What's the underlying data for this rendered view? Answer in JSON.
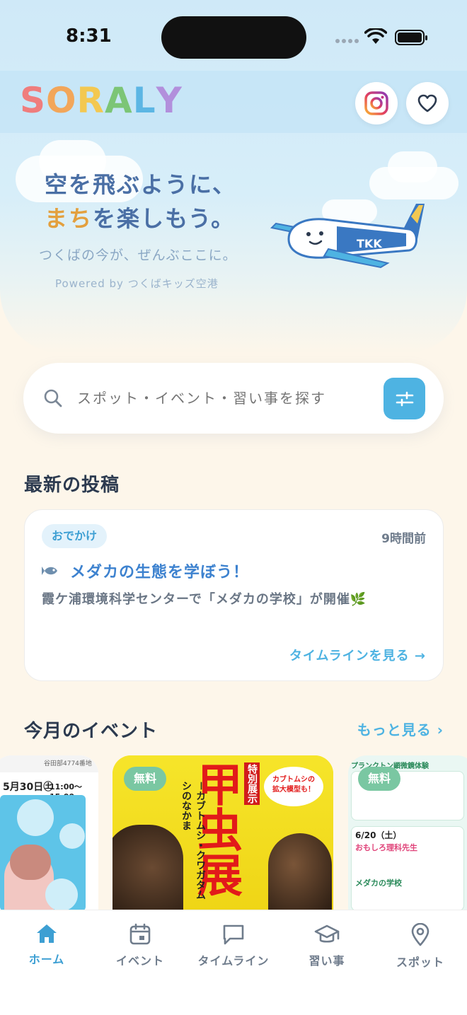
{
  "status_bar": {
    "time": "8:31"
  },
  "header": {
    "logo_letters": [
      {
        "char": "S",
        "color": "#ef7d7d"
      },
      {
        "char": "O",
        "color": "#f2a65a"
      },
      {
        "char": "R",
        "color": "#f3c851"
      },
      {
        "char": "A",
        "color": "#7cc576"
      },
      {
        "char": "L",
        "color": "#5cb6e4"
      },
      {
        "char": "Y",
        "color": "#b28fdc"
      }
    ],
    "instagram_icon": "instagram-icon",
    "favorite_icon": "heart-icon"
  },
  "hero": {
    "tagline_line1": "空を飛ぶように、",
    "tagline_line2_accent": "まち",
    "tagline_line2_rest": "を楽しもう。",
    "subtitle": "つくばの今が、ぜんぶここに。",
    "powered_by": "Powered by つくばキッズ空港",
    "plane_label": "TKK"
  },
  "search": {
    "placeholder": "スポット・イベント・習い事を探す",
    "filter_icon": "sliders-icon"
  },
  "latest": {
    "section_title": "最新の投稿",
    "post": {
      "tag": "おでかけ",
      "time": "9時間前",
      "title": "メダカの生態を学ぼう！",
      "title_icon": "fish-icon",
      "body": "霞ケ浦環境科学センターで「メダカの学校」が開催🌿",
      "link": "タイムラインを見る →"
    }
  },
  "events": {
    "section_title": "今月のイベント",
    "more_link": "もっと見る ›",
    "cards": [
      {
        "date": "5月30日㊏",
        "time": "11:00〜15:00",
        "header_text": "谷田部4774番地"
      },
      {
        "badge": "無料",
        "title_big": "甲虫展",
        "label": "特別展示",
        "subtitle": "－カブトムシ・クワガタムシのなかま",
        "bubble": "カブトムシの拡大模型も！"
      },
      {
        "badge": "無料",
        "heading1": "プランクトン顕微鏡体験",
        "heading2": "おもしろ理科先生",
        "date": "6/20（土）",
        "heading3": "メダカの学校"
      }
    ]
  },
  "nav": {
    "items": [
      {
        "label": "ホーム",
        "icon": "home-icon",
        "active": true
      },
      {
        "label": "イベント",
        "icon": "calendar-icon",
        "active": false
      },
      {
        "label": "タイムライン",
        "icon": "chat-icon",
        "active": false
      },
      {
        "label": "習い事",
        "icon": "graduation-cap-icon",
        "active": false
      },
      {
        "label": "スポット",
        "icon": "map-pin-icon",
        "active": false
      }
    ]
  },
  "colors": {
    "accent": "#4eb3e2",
    "heading_blue": "#4a6fa5",
    "accent_orange": "#e3a03e",
    "free_badge": "#7ac7a2"
  }
}
